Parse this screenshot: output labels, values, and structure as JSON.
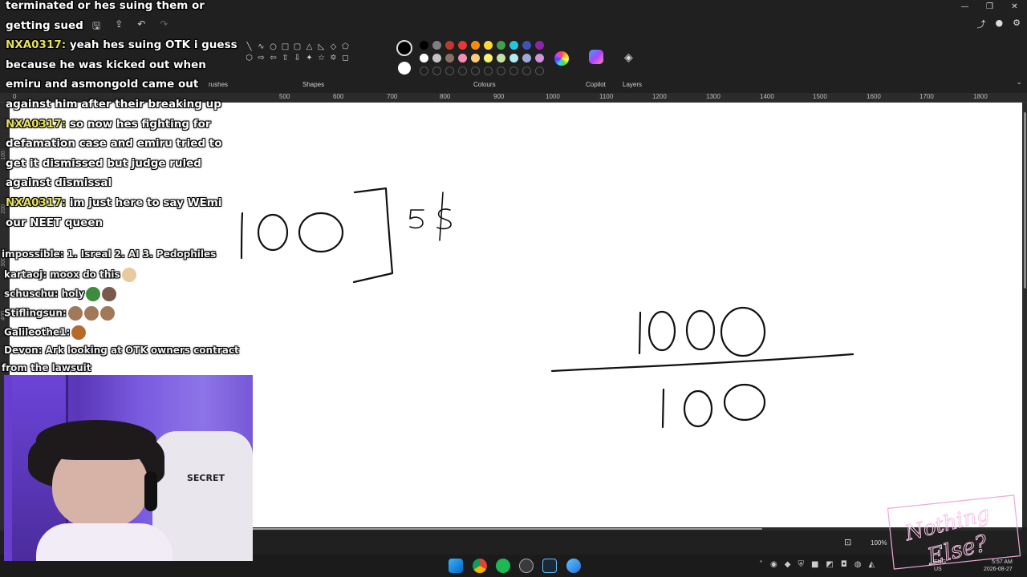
{
  "window": {
    "controls": [
      "—",
      "❐",
      "✕"
    ],
    "title_icons": [
      "share-icon",
      "profile-icon",
      "settings-icon"
    ]
  },
  "ribbon": {
    "groups": {
      "brushes": "rushes",
      "shapes": "Shapes",
      "colours": "Colours",
      "copilot": "Copilot",
      "layers": "Layers"
    },
    "primary_color": "#000000",
    "secondary_color": "#ffffff",
    "palette_row1": [
      "#000000",
      "#7f7f7f",
      "#c0392b",
      "#e53935",
      "#fb8c00",
      "#fdd835",
      "#43a047",
      "#26c6da",
      "#3f51b5",
      "#8e24aa"
    ],
    "palette_row2": [
      "#ffffff",
      "#c3c3c3",
      "#8d6e63",
      "#f48fb1",
      "#ffcc80",
      "#fff176",
      "#c5e1a5",
      "#b2ebf2",
      "#9fa8da",
      "#ce93d8"
    ]
  },
  "ruler": {
    "labels": [
      "0",
      "500",
      "600",
      "700",
      "800",
      "900",
      "1000",
      "1100",
      "1200",
      "1300",
      "1400",
      "1500",
      "1600",
      "1700",
      "1800"
    ]
  },
  "vruler": {
    "labels": [
      "100",
      "200",
      "300",
      "400"
    ]
  },
  "canvas": {
    "handwritten": [
      "100",
      "]",
      "5$",
      "1000",
      "100"
    ]
  },
  "statusbar": {
    "zoom": "100%"
  },
  "taskbar": {
    "language": "ENG\nUS",
    "time": "5:57 AM",
    "date": "2026-08-27"
  },
  "chat": {
    "big_lines": [
      {
        "user": "",
        "text": "terminated or hes suing them or"
      },
      {
        "user": "",
        "text": "getting sued"
      },
      {
        "user": "NXA0317:",
        "text": " yeah hes suing OTK i guess"
      },
      {
        "user": "",
        "text": "because he was kicked out when"
      },
      {
        "user": "",
        "text": "emiru and asmongold came out"
      },
      {
        "user": "",
        "text": "against him after their breaking up"
      },
      {
        "user": "NXA0317:",
        "text": " so now hes fighting for"
      },
      {
        "user": "",
        "text": "defamation case and emiru tried to"
      },
      {
        "user": "",
        "text": "get it dismissed but judge ruled"
      },
      {
        "user": "",
        "text": "against dismissal"
      },
      {
        "user": "NXA0317:",
        "text": " im just here to say WEmi"
      },
      {
        "user": "",
        "text": "our NEET queen"
      }
    ],
    "small_lines": [
      {
        "text": "impossible: 1. Isreal 2. AI 3. Pedophiles",
        "emotes": []
      },
      {
        "text": "kartaoj: moox do this",
        "emotes": [
          "#e8c9a0"
        ]
      },
      {
        "text": "schuschu: holy",
        "emotes": [
          "#3d8b3d",
          "#7a5a4a"
        ]
      },
      {
        "text": "Stiflingsun:",
        "emotes": [
          "#a0785a",
          "#a0785a",
          "#a0785a"
        ]
      },
      {
        "text": "Galileothe1:",
        "emotes": [
          "#b56a2c"
        ]
      },
      {
        "text": "Devon: Ark looking at OTK owners contract",
        "emotes": []
      },
      {
        "text": "from the lawsuit",
        "emotes": []
      }
    ]
  },
  "webcam": {
    "chair_brand": "SECRET"
  },
  "watermark": {
    "text": "Nothing Else?"
  }
}
